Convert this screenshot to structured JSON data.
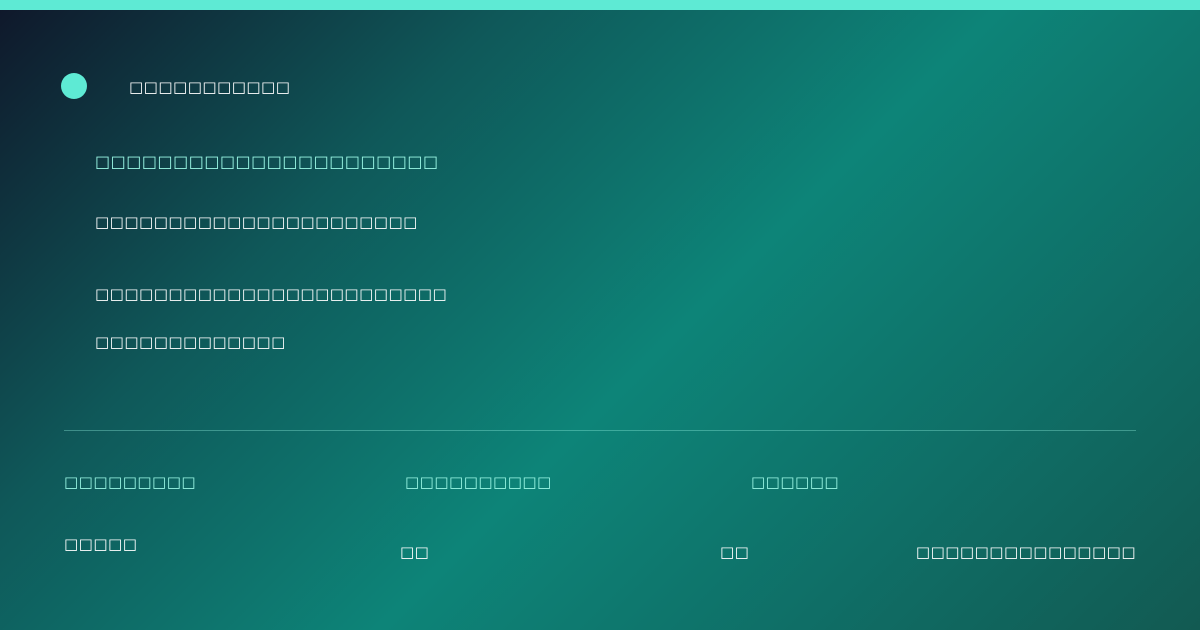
{
  "colors": {
    "accent": "#5eead4",
    "accent_light": "#99f6e4",
    "text": "#ffffff",
    "background_start": "#0f172a",
    "background_mid": "#0d8478",
    "background_end": "#125a52"
  },
  "brand": {
    "icon": "brand-dot-icon",
    "name": "□□□□□□□□□□□"
  },
  "hero": {
    "eyebrow": "□□□□□□□□□□□□□□□□□□□□□□",
    "headline": "□□□□□□□□□□□□□□□□□□□□□□",
    "description_lines": [
      "□□□□□□□□□□□□□□□□□□□□□□□□",
      "□□□□□□□□□□□□□"
    ]
  },
  "stats": [
    {
      "label": "□□□□□□□□□",
      "value": "□□□□□"
    },
    {
      "label": "□□□□□□□□□□",
      "value": "□□"
    },
    {
      "label": "□□□□□□",
      "value": "□□"
    }
  ],
  "footer": {
    "note": "□□□□□□□□□□□□□□□"
  }
}
